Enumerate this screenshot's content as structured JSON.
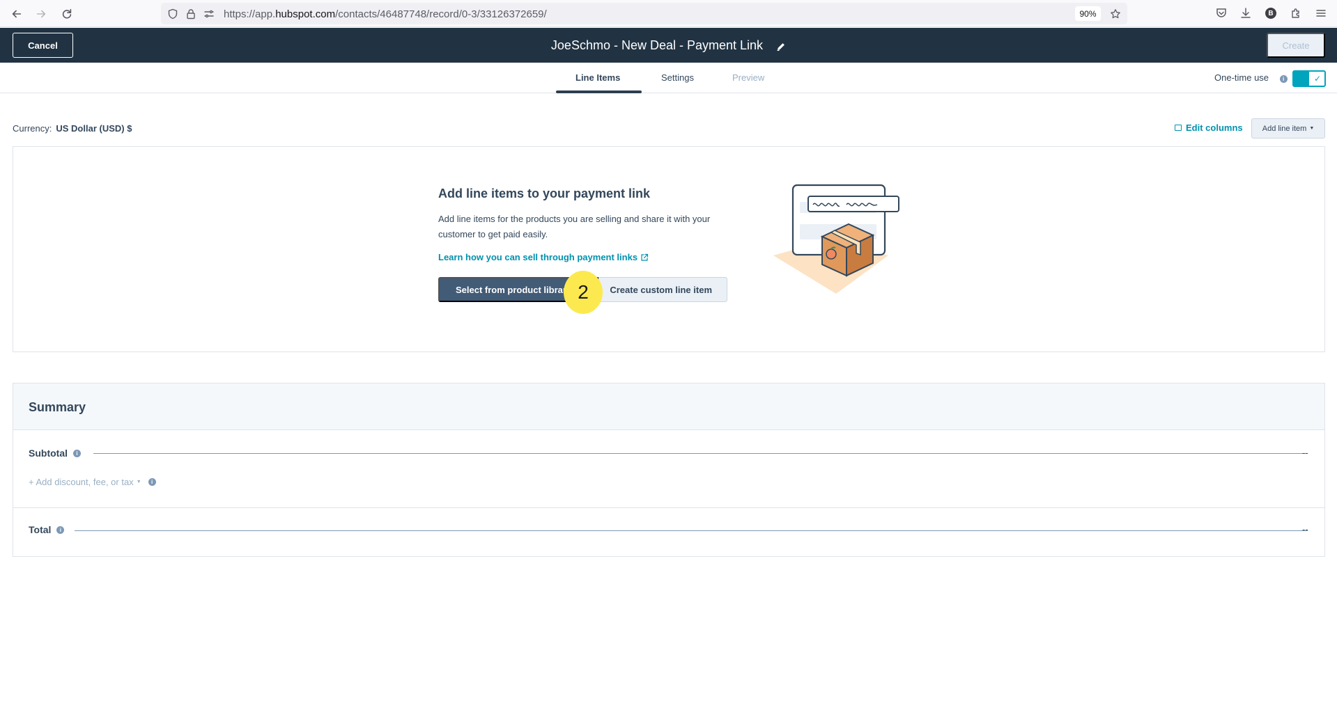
{
  "browser": {
    "url_prefix": "https://app.",
    "url_domain": "hubspot.com",
    "url_path": "/contacts/46487748/record/0-3/33126372659/",
    "zoom": "90%",
    "profile_initial": "B"
  },
  "header": {
    "cancel_label": "Cancel",
    "title": "JoeSchmo - New Deal - Payment Link",
    "create_label": "Create"
  },
  "tabs": [
    {
      "label": "Line Items",
      "state": "active"
    },
    {
      "label": "Settings",
      "state": "normal"
    },
    {
      "label": "Preview",
      "state": "disabled"
    }
  ],
  "one_time_use": {
    "label": "One-time use",
    "enabled": true
  },
  "currency": {
    "label": "Currency:",
    "value": "US Dollar (USD) $"
  },
  "toolbar": {
    "edit_columns": "Edit columns",
    "add_line_item": "Add line item"
  },
  "empty_state": {
    "title": "Add line items to your payment link",
    "description": "Add line items for the products you are selling and share it with your customer to get paid easily.",
    "learn_link": "Learn how you can sell through payment links",
    "select_button": "Select from product library",
    "custom_button": "Create custom line item",
    "step_marker": "2"
  },
  "summary": {
    "title": "Summary",
    "subtotal_label": "Subtotal",
    "subtotal_value": "--",
    "add_discount": "+ Add discount, fee, or tax",
    "total_label": "Total",
    "total_value": "--"
  },
  "colors": {
    "header_bg": "#213343",
    "link": "#0091ae",
    "toggle": "#00a4bd",
    "primary_button": "#425b76",
    "step_marker": "#fce94f"
  }
}
